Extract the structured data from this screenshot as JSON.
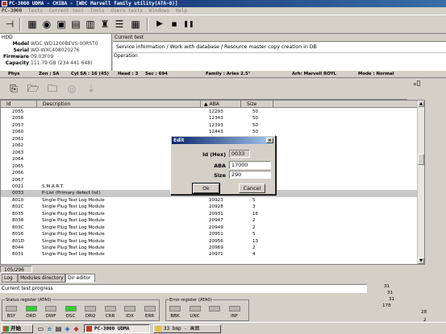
{
  "window": {
    "title": "PC-3000 UDMA - CHIBA - [WDC Marvell family utility(ATA-0)]",
    "menu": [
      "PC-3000",
      "Tests",
      "Current test",
      "Tools",
      "Users tests",
      "Windows",
      "Help"
    ]
  },
  "toolbar": {
    "icons": [
      "pin-icon",
      "drive-icon",
      "disk-icon",
      "chip-icon",
      "chip2-icon",
      "chip3-icon",
      "wrench-icon",
      "chart-icon",
      "grid-icon",
      "play-icon",
      "stop-icon",
      "pause-icon"
    ]
  },
  "hdd": {
    "heading": "HDD",
    "fields": [
      {
        "label": "Model",
        "value": "WDC WD1200BEVS-00RST0"
      },
      {
        "label": "Serial",
        "value": "WD-WXC408020276"
      },
      {
        "label": "Firmware",
        "value": "09.03F09"
      },
      {
        "label": "Capacity",
        "value": "111.79 GB (234 441 648)"
      }
    ]
  },
  "current_test": {
    "label": "Current test",
    "value": "Service information / Work with database / Resource master copy creation in DB",
    "operation_label": "Operation"
  },
  "infobar": {
    "phys": "Phys",
    "zone": "Zon : SA",
    "cyl": "Cyl SA : 16 (45)",
    "head": "Head : 3",
    "sec": "Sec : 694",
    "family": "Family : Aries 2.5\"",
    "arh": "Arh: Marvell ROYL",
    "mode": "Mode : Normal"
  },
  "list": {
    "columns": [
      "Id",
      "Description",
      "ABA",
      "Size"
    ],
    "rows": [
      {
        "id": "2055",
        "desc": "",
        "aba": "12293",
        "size": "50"
      },
      {
        "id": "2056",
        "desc": "",
        "aba": "12343",
        "size": "50"
      },
      {
        "id": "2057",
        "desc": "",
        "aba": "12393",
        "size": "50"
      },
      {
        "id": "2060",
        "desc": "",
        "aba": "12443",
        "size": "50"
      },
      {
        "id": "2061",
        "desc": "",
        "aba": "",
        "size": ""
      },
      {
        "id": "2062",
        "desc": "",
        "aba": "",
        "size": ""
      },
      {
        "id": "2063",
        "desc": "",
        "aba": "",
        "size": ""
      },
      {
        "id": "2064",
        "desc": "",
        "aba": "",
        "size": ""
      },
      {
        "id": "2065",
        "desc": "",
        "aba": "",
        "size": ""
      },
      {
        "id": "2066",
        "desc": "",
        "aba": "",
        "size": ""
      },
      {
        "id": "2067",
        "desc": "",
        "aba": "",
        "size": ""
      },
      {
        "id": "0021",
        "desc": "S.M.A.R.T.",
        "aba": "",
        "size": ""
      },
      {
        "id": "0033",
        "desc": "P-List (Primary defect list)",
        "aba": "17000",
        "size": "290"
      },
      {
        "id": "8010",
        "desc": "Single Plug Test Log Module",
        "aba": "20923",
        "size": "5"
      },
      {
        "id": "802C",
        "desc": "Single Plug Test Log Module",
        "aba": "20928",
        "size": "3"
      },
      {
        "id": "8035",
        "desc": "Single Plug Test Log Module",
        "aba": "20931",
        "size": "16"
      },
      {
        "id": "8038",
        "desc": "Single Plug Test Log Module",
        "aba": "20947",
        "size": "2"
      },
      {
        "id": "803C",
        "desc": "Single Plug Test Log Module",
        "aba": "20949",
        "size": "2"
      },
      {
        "id": "8016",
        "desc": "Single Plug Test Log Module",
        "aba": "20951",
        "size": "5"
      },
      {
        "id": "801D",
        "desc": "Single Plug Test Log Module",
        "aba": "20956",
        "size": "13"
      },
      {
        "id": "8044",
        "desc": "Single Plug Test Log Module",
        "aba": "20969",
        "size": "2"
      },
      {
        "id": "8031",
        "desc": "Single Plug Test Log Module",
        "aba": "20971",
        "size": "4"
      }
    ],
    "selected_index": 12
  },
  "statusbar": {
    "count": "105/296"
  },
  "tabs": [
    "Log",
    "Modules directory",
    "Dir editor"
  ],
  "progress_label": "Current test progress",
  "status_register": {
    "label": "Status register (ATA0)",
    "leds": [
      {
        "name": "BSY",
        "on": false
      },
      {
        "name": "DRD",
        "on": true
      },
      {
        "name": "DWF",
        "on": false
      },
      {
        "name": "DSC",
        "on": true
      },
      {
        "name": "DRQ",
        "on": false
      },
      {
        "name": "CRR",
        "on": false
      },
      {
        "name": "IDX",
        "on": false
      },
      {
        "name": "ERR",
        "on": false
      }
    ]
  },
  "error_register": {
    "label": "Error register (ATA0)",
    "leds": [
      {
        "name": "BBK",
        "on": false
      },
      {
        "name": "UNC",
        "on": false
      },
      {
        "name": "",
        "on": false
      },
      {
        "name": "INF",
        "on": false
      }
    ]
  },
  "side_numbers": [
    "31",
    "31",
    "31",
    "178",
    "28",
    "2",
    "4"
  ],
  "dialog": {
    "title": "Edit",
    "id_label": "Id (Hex)",
    "id_value": "0033",
    "aba_label": "ABA",
    "aba_value": "17000",
    "size_label": "Size",
    "size_value": "290",
    "ok": "Ok",
    "cancel": "Cancel"
  },
  "taskbar": {
    "start": "开始",
    "items": [
      "PC-3000 UDMA",
      "33 bmp - 画图"
    ]
  },
  "colors": {
    "title_bar": "#0a246a",
    "led_on": "#2ad42a",
    "window_bg": "#d4d0c8"
  }
}
